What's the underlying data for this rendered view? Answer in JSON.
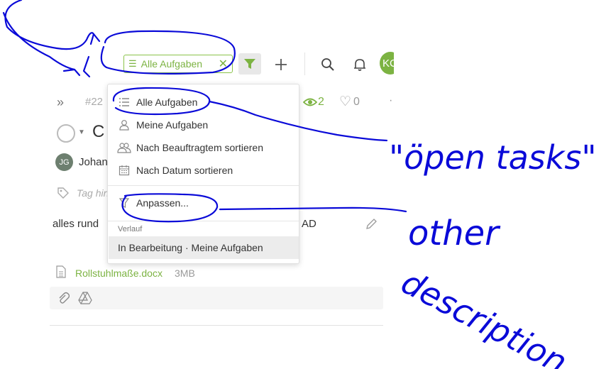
{
  "toolbar": {
    "filter_chip_label": "Alle Aufgaben",
    "avatar_initials": "KC"
  },
  "task": {
    "breadcrumb_id": "#22",
    "title_initial": "C",
    "watchers_count": "2",
    "likes_count": "0",
    "assignee_initials": "JG",
    "assignee_name": "Johan",
    "tags_placeholder": "Tag hin",
    "description_start": "alles rund",
    "description_end": "AD",
    "attachment_name": "Rollstuhlmaße.docx",
    "attachment_size": "3MB"
  },
  "menu": {
    "items": [
      {
        "label": "Alle Aufgaben",
        "icon": "list-icon"
      },
      {
        "label": "Meine Aufgaben",
        "icon": "user-icon"
      },
      {
        "label": "Nach Beauftragtem sortieren",
        "icon": "users-icon"
      },
      {
        "label": "Nach Datum sortieren",
        "icon": "calendar-icon"
      }
    ],
    "customize_label": "Anpassen...",
    "history_heading": "Verlauf",
    "history_item": "In Bearbeitung · Meine Aufgaben"
  },
  "annotations": {
    "note_open_tasks": "\"öpen tasks\"",
    "note_other": "other",
    "note_description": "description"
  },
  "colors": {
    "accent_green": "#7cb342",
    "annotation_blue": "#0a0ad8"
  }
}
